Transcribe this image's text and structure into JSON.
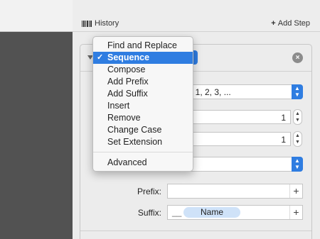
{
  "toolbar": {
    "history_label": "History",
    "add_step_label": "Add Step"
  },
  "step_menu": {
    "items": [
      {
        "label": "Find and Replace",
        "selected": false
      },
      {
        "label": "Sequence",
        "selected": true
      },
      {
        "label": "Compose",
        "selected": false
      },
      {
        "label": "Add Prefix",
        "selected": false
      },
      {
        "label": "Add Suffix",
        "selected": false
      },
      {
        "label": "Insert",
        "selected": false
      },
      {
        "label": "Remove",
        "selected": false
      },
      {
        "label": "Change Case",
        "selected": false
      },
      {
        "label": "Set Extension",
        "selected": false
      }
    ],
    "advanced_label": "Advanced",
    "checkmark": "✓"
  },
  "panel": {
    "format_value_visible": "c: 1, 2, 3, ...",
    "start_value": "1",
    "step_value": "1",
    "prefix_label": "Prefix:",
    "prefix_value": "",
    "suffix_label": "Suffix:",
    "suffix_underscore": "__",
    "suffix_token": "Name"
  },
  "colors": {
    "accent": "#2f7de1",
    "sidebar": "#525252",
    "token_bg": "#cfe2f8"
  }
}
